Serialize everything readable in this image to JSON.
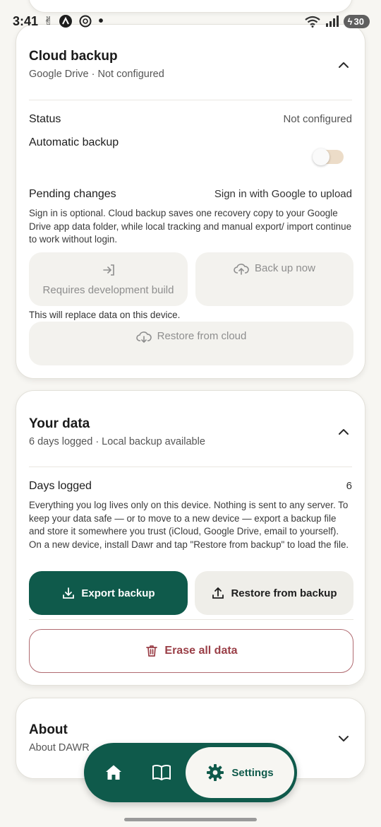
{
  "status_bar": {
    "time": "3:41",
    "battery": "30"
  },
  "cloud_backup": {
    "title": "Cloud backup",
    "subtitle": "Google Drive · Not configured",
    "status_label": "Status",
    "status_value": "Not configured",
    "auto_backup_label": "Automatic backup",
    "auto_backup_on": false,
    "pending_label": "Pending changes",
    "pending_value": "Sign in with Google to upload",
    "description": "Sign in is optional. Cloud backup saves one recovery copy to your Google Drive app data folder, while local tracking and manual export/ import continue to work without login.",
    "signin_button": "Requires development build",
    "backup_now_button": "Back up now",
    "replace_note": "This will replace data on this device.",
    "restore_cloud_button": "Restore from cloud"
  },
  "your_data": {
    "title": "Your data",
    "subtitle": "6 days logged · Local backup available",
    "days_label": "Days logged",
    "days_value": "6",
    "description": "Everything you log lives only on this device. Nothing is sent to any server. To keep your data safe — or to move to a new device — export a backup file and store it somewhere you trust (iCloud, Google Drive, email to yourself). On a new device, install Dawr and tap \"Restore from backup\" to load the file.",
    "export_button": "Export backup",
    "restore_button": "Restore from backup",
    "erase_button": "Erase all data"
  },
  "about": {
    "title": "About",
    "subtitle": "About DAWR"
  },
  "bottom_nav": {
    "active_label": "Settings"
  },
  "colors": {
    "primary": "#0f5a4b",
    "danger": "#9a3f47",
    "background": "#f7f6f2"
  }
}
